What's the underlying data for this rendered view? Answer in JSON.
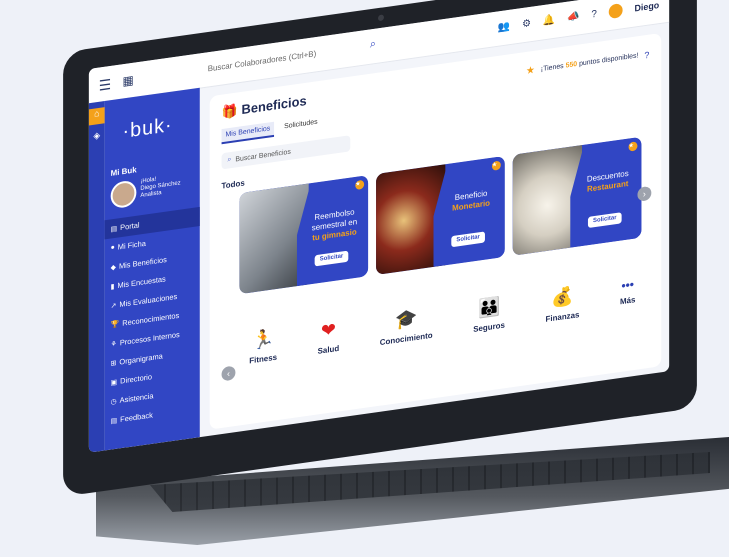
{
  "topbar": {
    "menu_icon": "hamburger-icon",
    "calendar_icon": "calendar-icon",
    "search_placeholder": "Buscar Colaboradores (Ctrl+B)",
    "user_name": "Diego"
  },
  "sidebar": {
    "logo": "·buk·",
    "section": "Mi Buk",
    "greeting": "¡Hola!",
    "user_full": "Diego Sánchez",
    "user_role": "Analista",
    "items": [
      {
        "label": "Portal",
        "icon": "portal-icon"
      },
      {
        "label": "Mi Ficha",
        "icon": "user-icon"
      },
      {
        "label": "Mis Beneficios",
        "icon": "benefits-icon"
      },
      {
        "label": "Mis Encuestas",
        "icon": "survey-icon"
      },
      {
        "label": "Mis Evaluaciones",
        "icon": "chart-icon"
      },
      {
        "label": "Reconocimientos",
        "icon": "trophy-icon"
      },
      {
        "label": "Procesos Internos",
        "icon": "process-icon"
      },
      {
        "label": "Organigrama",
        "icon": "org-icon"
      },
      {
        "label": "Directorio",
        "icon": "directory-icon"
      },
      {
        "label": "Asistencia",
        "icon": "clock-icon"
      },
      {
        "label": "Feedback",
        "icon": "feedback-icon"
      }
    ]
  },
  "main": {
    "title": "Beneficios",
    "tabs": [
      "Mis Beneficios",
      "Solicitudes"
    ],
    "points_prefix": "¡Tienes ",
    "points_value": "550",
    "points_suffix": " puntos disponibles!",
    "search_placeholder": "Buscar Beneficios",
    "section_title": "Todos",
    "cards": [
      {
        "line1": "Reembolso",
        "line2": "semestral en",
        "highlight": "tu gimnasio",
        "button": "Solicitar"
      },
      {
        "line1": "Beneficio",
        "line2": "",
        "highlight": "Monetario",
        "button": "Solicitar"
      },
      {
        "line1": "Descuentos",
        "line2": "",
        "highlight": "Restaurant",
        "button": "Solicitar"
      }
    ],
    "categories": [
      {
        "label": "Fitness",
        "icon": "runner-icon",
        "glyph": "🏃"
      },
      {
        "label": "Salud",
        "icon": "heart-icon",
        "glyph": "❤"
      },
      {
        "label": "Conocimiento",
        "icon": "graduation-cap-icon",
        "glyph": "🎓"
      },
      {
        "label": "Seguros",
        "icon": "family-icon",
        "glyph": "👪"
      },
      {
        "label": "Finanzas",
        "icon": "money-bag-icon",
        "glyph": "💰"
      },
      {
        "label": "Más",
        "icon": "more-icon",
        "glyph": "•••"
      }
    ]
  },
  "colors": {
    "primary": "#3146c4",
    "accent": "#f4a11a",
    "dark": "#1e2a55"
  }
}
